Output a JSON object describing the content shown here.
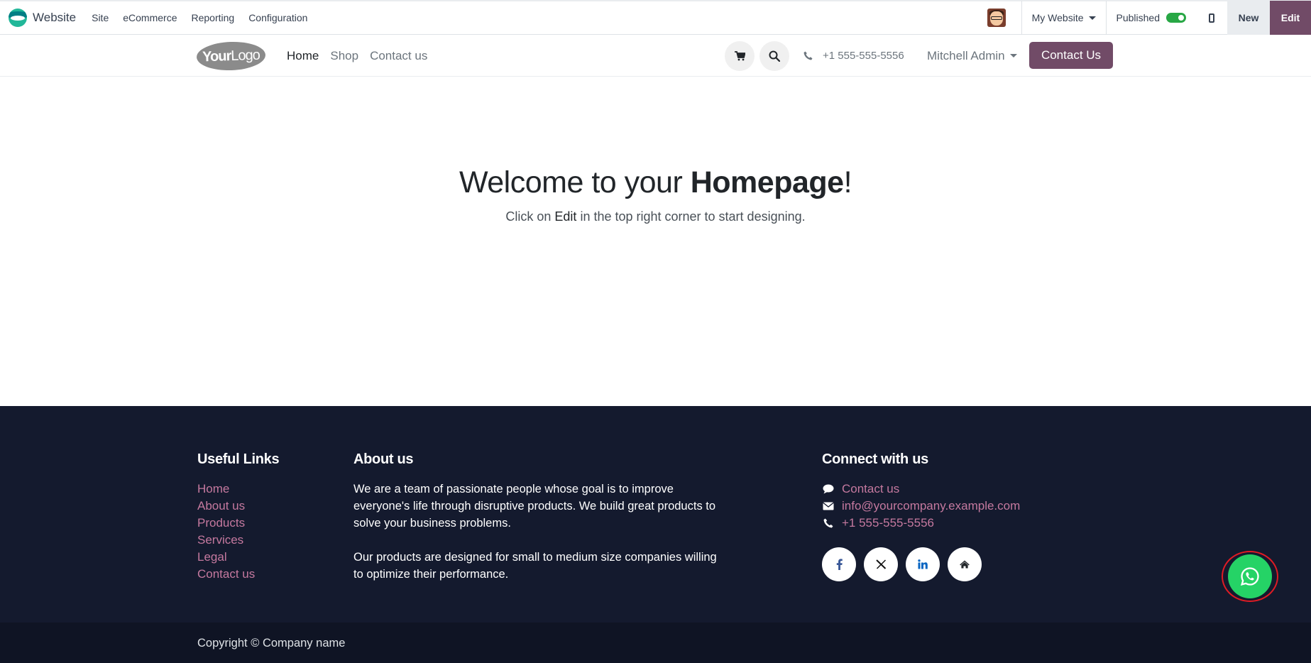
{
  "admin_bar": {
    "app_name": "Website",
    "menu": [
      "Site",
      "eCommerce",
      "Reporting",
      "Configuration"
    ],
    "website_selector": "My Website",
    "published_label": "Published",
    "published": true,
    "new_label": "New",
    "edit_label": "Edit"
  },
  "site_header": {
    "logo_text_bold": "Your",
    "logo_text": "Logo",
    "nav": [
      "Home",
      "Shop",
      "Contact us"
    ],
    "phone": "+1 555-555-5556",
    "user": "Mitchell Admin",
    "cta_label": "Contact Us"
  },
  "hero": {
    "title_prefix": "Welcome to your ",
    "title_bold": "Homepage",
    "title_suffix": "!",
    "subtitle_prefix": "Click on ",
    "subtitle_emphasis": "Edit",
    "subtitle_suffix": " in the top right corner to start designing."
  },
  "footer": {
    "useful_links": {
      "heading": "Useful Links",
      "links": [
        "Home",
        "About us",
        "Products",
        "Services",
        "Legal",
        "Contact us"
      ]
    },
    "about": {
      "heading": "About us",
      "paragraph1": "We are a team of passionate people whose goal is to improve everyone's life through disruptive products. We build great products to solve your business problems.",
      "paragraph2": "Our products are designed for small to medium size companies willing to optimize their performance."
    },
    "connect": {
      "heading": "Connect with us",
      "contact_label": "Contact us",
      "email": "info@yourcompany.example.com",
      "phone": "+1 555-555-5556",
      "social_icons": [
        "facebook-icon",
        "x-twitter-icon",
        "linkedin-icon",
        "home-icon"
      ]
    },
    "copyright": "Copyright © Company name"
  },
  "colors": {
    "brand": "#714b67",
    "footer_bg": "#141a2e",
    "footer_link": "#c5799f",
    "toggle_on": "#28a745",
    "whatsapp": "#25d366",
    "highlight_ring": "#e01b24"
  }
}
